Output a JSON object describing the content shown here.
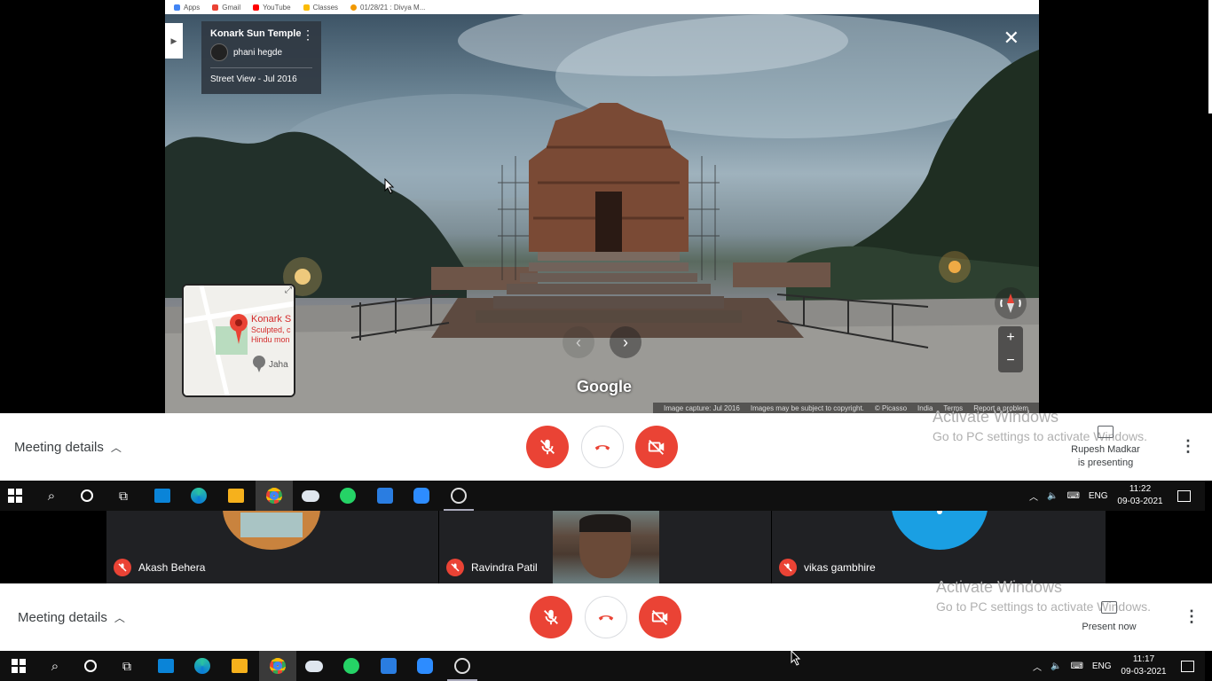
{
  "browser": {
    "bookmarks": [
      {
        "label": "Apps",
        "color": "#4285f4"
      },
      {
        "label": "Gmail",
        "color": "#ea4335"
      },
      {
        "label": "YouTube",
        "color": "#ff0000"
      },
      {
        "label": "Classes",
        "color": "#fbbc05"
      },
      {
        "label": "01/28/21 : Divya M...",
        "color": "#f29900"
      }
    ]
  },
  "streetview": {
    "place_title": "Konark Sun Temple",
    "author": "phani hegde",
    "capture_label": "Street View - Jul 2016",
    "minimap_label_1": "Konark S",
    "minimap_label_2": "Sculpted, c",
    "minimap_label_3": "Hindu mon",
    "minimap_label_4": "Jaha",
    "logo": "Google",
    "attribution": [
      "Image capture: Jul 2016",
      "Images may be subject to copyright.",
      "© Picasso",
      "India",
      "Terms",
      "Report a problem"
    ],
    "zoom_in": "+",
    "zoom_out": "−"
  },
  "meet_top": {
    "details_label": "Meeting details",
    "presenter_line1": "Rupesh Madkar",
    "presenter_line2": "is presenting"
  },
  "meet_bottom": {
    "details_label": "Meeting details",
    "present_label": "Present now"
  },
  "activate_windows": {
    "line1": "Activate Windows",
    "line2": "Go to PC settings to activate Windows."
  },
  "taskbar_top": {
    "time": "11:22",
    "date": "09-03-2021",
    "lang": "ENG"
  },
  "taskbar_bottom": {
    "time": "11:17",
    "date": "09-03-2021",
    "lang": "ENG"
  },
  "participants": [
    {
      "name": "Akash Behera"
    },
    {
      "name": "Ravindra Patil"
    },
    {
      "name": "vikas gambhire"
    }
  ],
  "colors": {
    "meet_red": "#ea4335",
    "accent_blue": "#1a9fe3"
  }
}
